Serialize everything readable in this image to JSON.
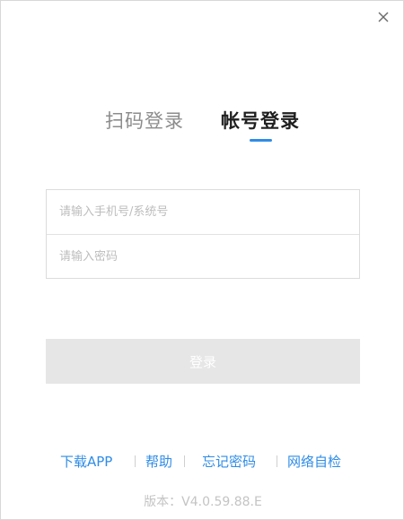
{
  "tabs": {
    "qr_login": "扫码登录",
    "account_login": "帐号登录"
  },
  "form": {
    "account_placeholder": "请输入手机号/系统号",
    "password_placeholder": "请输入密码",
    "account_value": "",
    "password_value": ""
  },
  "login_button": "登录",
  "footer": {
    "download_app": "下载APP",
    "help": "帮助",
    "forgot_password": "忘记密码",
    "network_check": "网络自检"
  },
  "version": "版本：V4.0.59.88.E",
  "icons": {
    "close": "close-icon"
  },
  "colors": {
    "accent": "#2f8ce6",
    "active_tab_text": "#1f1f1f",
    "inactive_tab_text": "#8c8c8c",
    "disabled_button": "#e6e6e6"
  }
}
